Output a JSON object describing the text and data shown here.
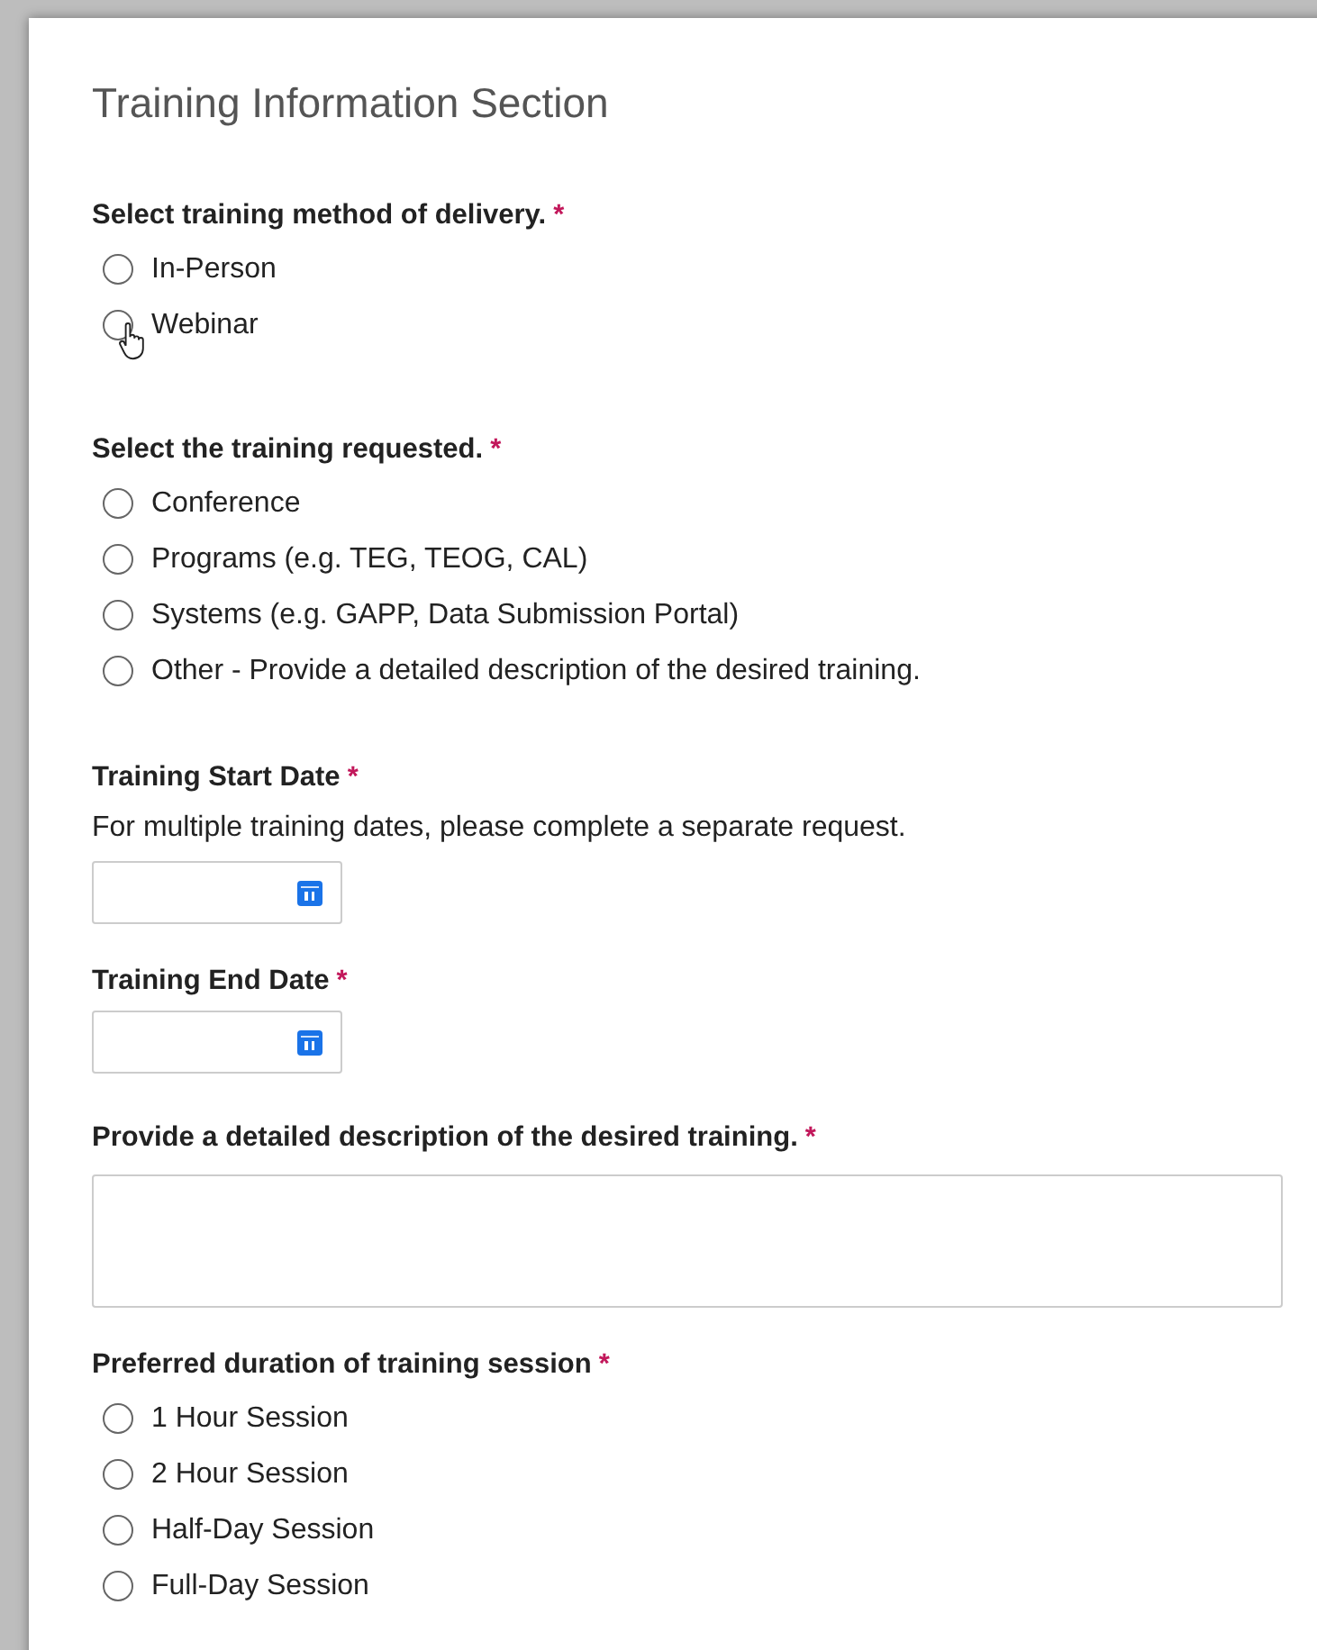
{
  "section_title": "Training Information Section",
  "questions": [
    {
      "kind": "radio",
      "label": "Select training method of delivery.",
      "required": "*",
      "options": [
        {
          "label": "In-Person",
          "selected": false,
          "hovered": false
        },
        {
          "label": "Webinar",
          "selected": false,
          "hovered": true
        }
      ]
    },
    {
      "kind": "radio",
      "label": "Select the training requested.",
      "required": "*",
      "options": [
        {
          "label": "Conference",
          "selected": false
        },
        {
          "label": "Programs (e.g. TEG, TEOG, CAL)",
          "selected": false
        },
        {
          "label": "Systems (e.g. GAPP, Data Submission Portal)",
          "selected": false
        },
        {
          "label": "Other - Provide a detailed description of the desired training.",
          "selected": false
        }
      ]
    },
    {
      "kind": "date",
      "label": "Training Start Date",
      "required": "*",
      "help": "For multiple training dates, please complete a separate request."
    },
    {
      "kind": "date",
      "label": "Training End Date",
      "required": "*"
    },
    {
      "kind": "textarea",
      "label": "Provide a detailed description of the desired training.",
      "required": "*"
    },
    {
      "kind": "radio",
      "label": "Preferred duration of training session",
      "required": "*",
      "options": [
        {
          "label": "1 Hour Session",
          "selected": false
        },
        {
          "label": "2 Hour Session",
          "selected": false
        },
        {
          "label": "Half-Day Session",
          "selected": false
        },
        {
          "label": "Full-Day Session",
          "selected": false
        }
      ]
    }
  ]
}
